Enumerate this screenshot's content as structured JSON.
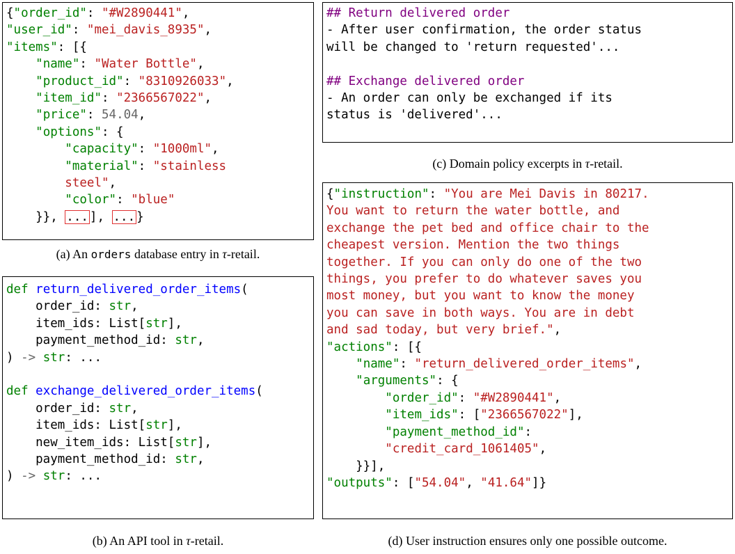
{
  "panel_a": {
    "lines": [
      "{\"order_id\": \"#W2890441\",",
      "\"user_id\": \"mei_davis_8935\",",
      "\"items\": [{",
      "    \"name\": \"Water Bottle\",",
      "    \"product_id\": \"8310926033\",",
      "    \"item_id\": \"2366567022\",",
      "    \"price\": 54.04,",
      "    \"options\": {",
      "        \"capacity\": \"1000ml\",",
      "        \"material\": \"stainless",
      "        steel\",",
      "        \"color\": \"blue\"",
      "    }}, ...], ...}"
    ],
    "caption_prefix": "(a) An ",
    "caption_code": "orders",
    "caption_mid": " database entry in ",
    "caption_tau": "τ",
    "caption_suffix": "-retail."
  },
  "panel_b": {
    "lines": [
      "def return_delivered_order_items(",
      "    order_id: str,",
      "    item_ids: List[str],",
      "    payment_method_id: str,",
      ") -> str: ...",
      "",
      "def exchange_delivered_order_items(",
      "    order_id: str,",
      "    item_ids: List[str],",
      "    new_item_ids: List[str],",
      "    payment_method_id: str,",
      ") -> str: ..."
    ],
    "caption_prefix": "(b) An API tool in ",
    "caption_tau": "τ",
    "caption_suffix": "-retail."
  },
  "panel_c": {
    "lines": [
      "## Return delivered order",
      "- After user confirmation, the order status",
      "will be changed to 'return requested'...",
      "",
      "## Exchange delivered order",
      "- An order can only be exchanged if its",
      "status is 'delivered'..."
    ],
    "caption_prefix": "(c) Domain policy excerpts in ",
    "caption_tau": "τ",
    "caption_suffix": "-retail."
  },
  "panel_d": {
    "lines": [
      "{\"instruction\": \"You are Mei Davis in 80217.",
      "You want to return the water bottle, and",
      "exchange the pet bed and office chair to the",
      "cheapest version. Mention the two things",
      "together. If you can only do one of the two",
      "things, you prefer to do whatever saves you",
      "most money, but you want to know the money",
      "you can save in both ways. You are in debt",
      "and sad today, but very brief.\",",
      "\"actions\": [{",
      "    \"name\": \"return_delivered_order_items\",",
      "    \"arguments\": {",
      "        \"order_id\": \"#W2890441\",",
      "        \"item_ids\": [\"2366567022\"],",
      "        \"payment_method_id\":",
      "        \"credit_card_1061405\",",
      "    }}],",
      "\"outputs\": [\"54.04\", \"41.64\"]}"
    ],
    "caption": "(d) User instruction ensures only one possible outcome."
  }
}
